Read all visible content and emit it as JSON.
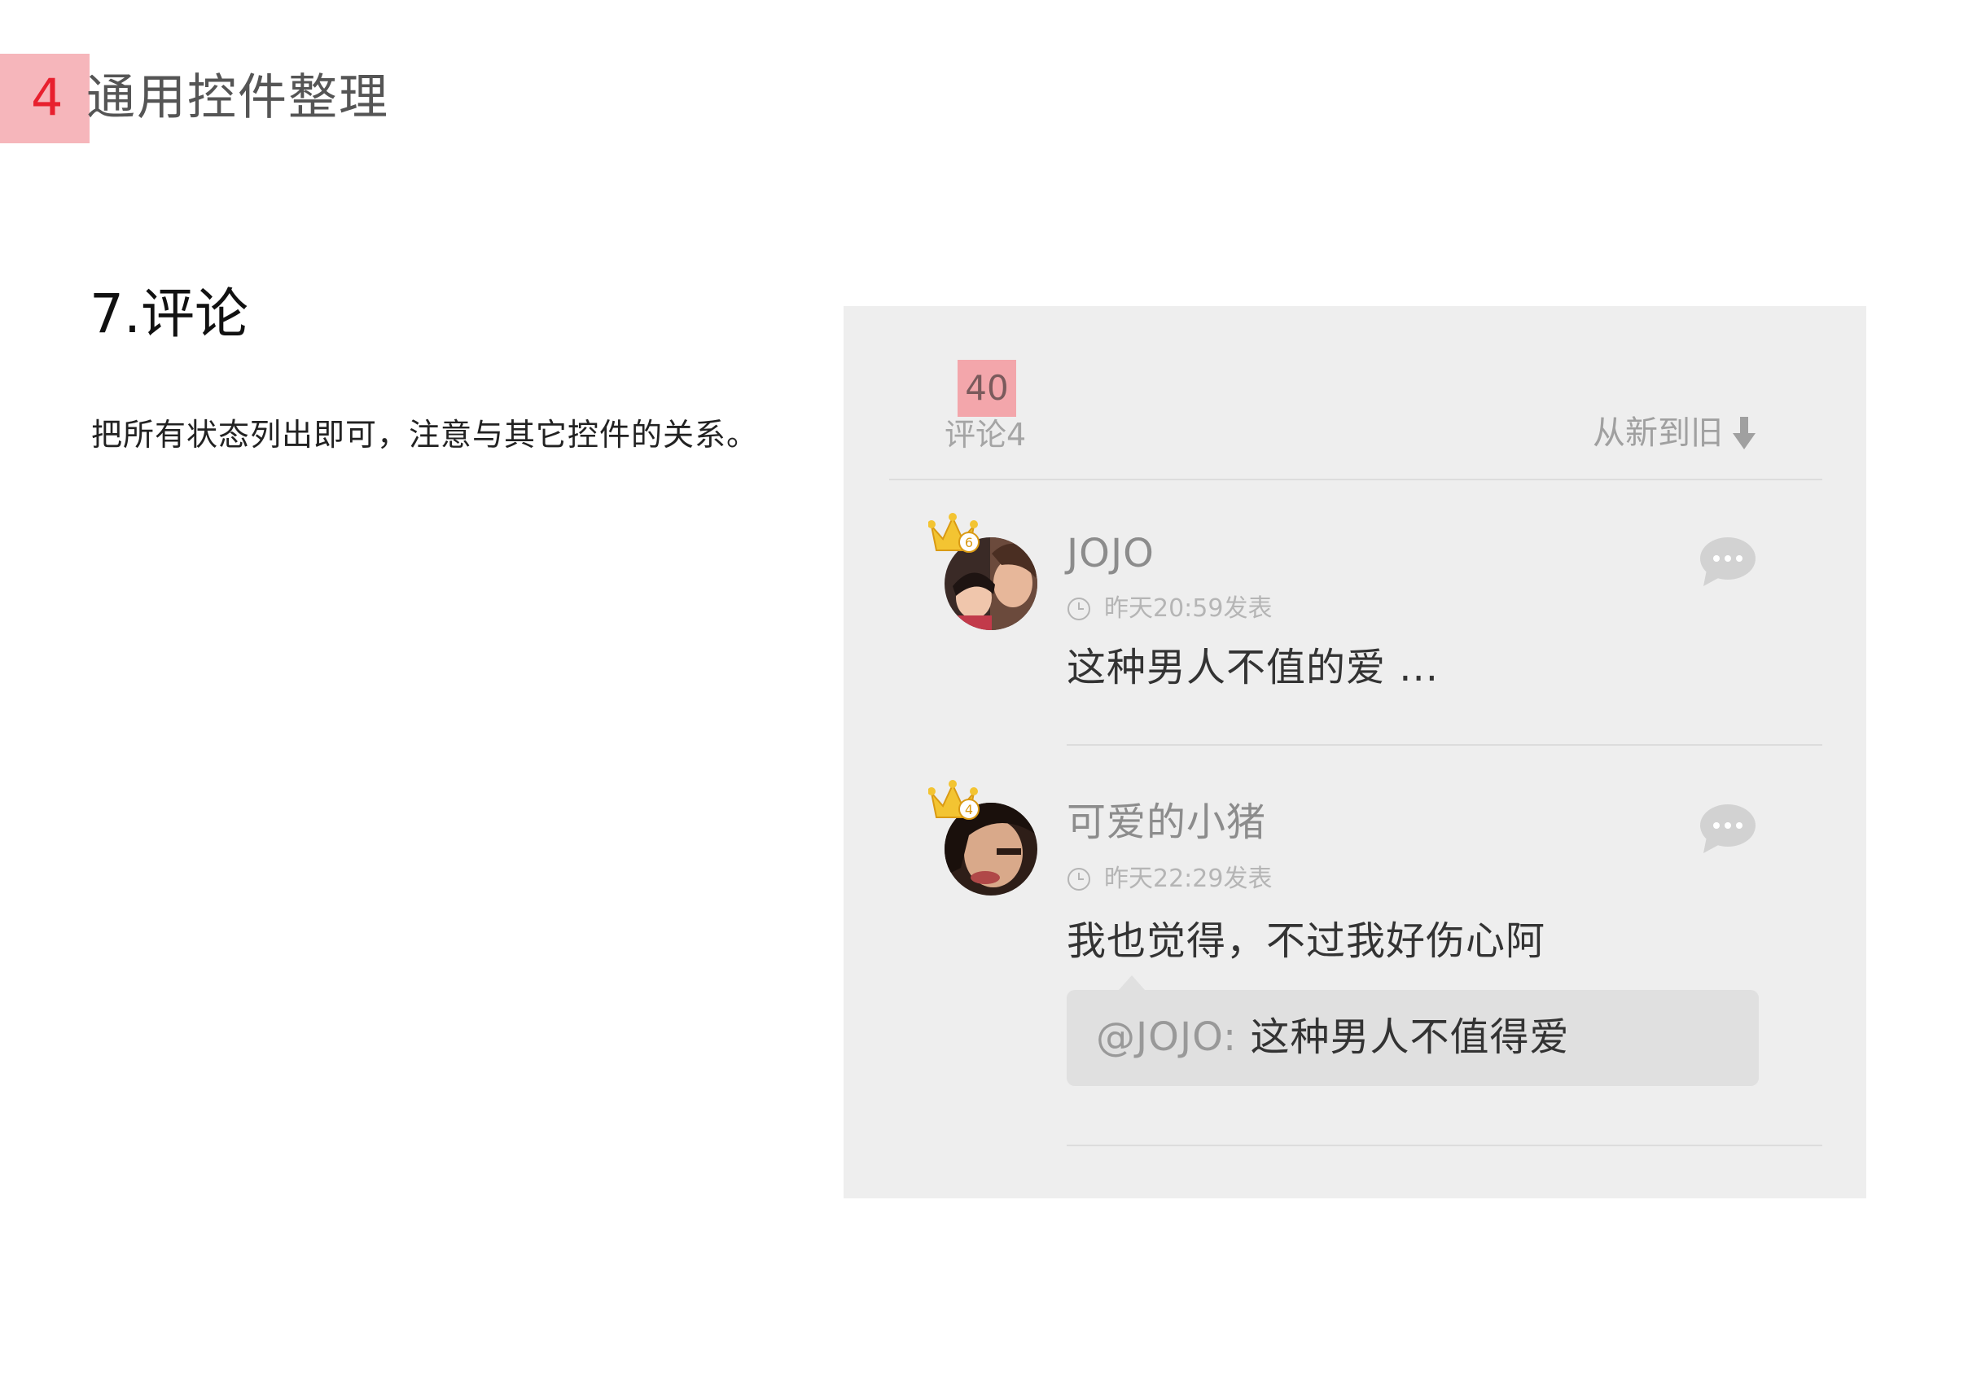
{
  "section": {
    "number": "4",
    "title": "通用控件整理"
  },
  "item": {
    "title": "7.评论",
    "description": "把所有状态列出即可，注意与其它控件的关系。"
  },
  "panel": {
    "count_badge": "40",
    "count_label": "评论4",
    "sort_label": "从新到旧",
    "sort_icon": "arrow-down-icon"
  },
  "comments": [
    {
      "user": "JOJO",
      "level": "6",
      "time": "昨天20:59发表",
      "content": "这种男人不值的爱 ...",
      "reply_icon": "comment-bubble-icon"
    },
    {
      "user": "可爱的小猪",
      "level": "4",
      "time": "昨天22:29发表",
      "content": "我也觉得，不过我好伤心阿",
      "quote": {
        "user": "@JOJO:",
        "text": "这种男人不值得爱"
      },
      "reply_icon": "comment-bubble-icon"
    }
  ],
  "colors": {
    "accent_red": "#e8202e",
    "badge_pink": "#f6b6bb",
    "panel_bg": "#eeeeee",
    "crown_gold": "#f3c432"
  }
}
